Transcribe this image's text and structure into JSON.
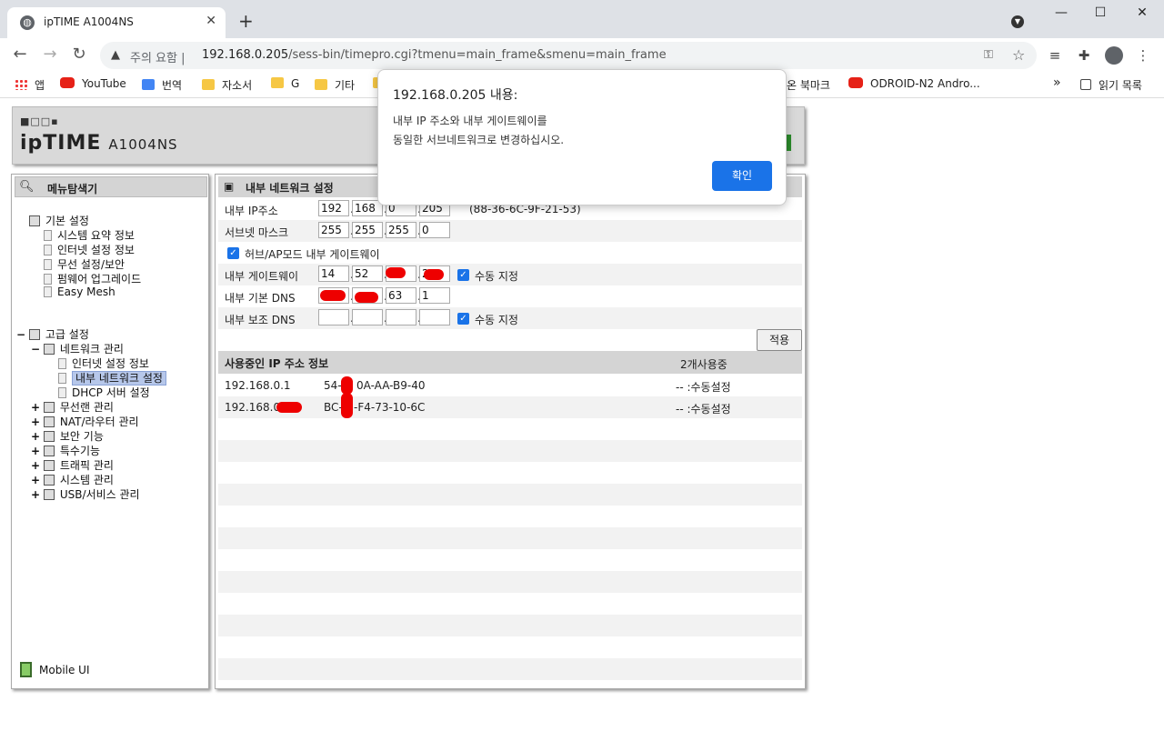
{
  "browser": {
    "tab_title": "ipTIME A1004NS",
    "tab_close": "✕",
    "new_tab": "+",
    "window_controls": {
      "minimize": "—",
      "maximize": "☐",
      "close": "✕"
    },
    "security_label": "주의 요함",
    "url_host": "192.168.0.205",
    "url_path": "/sess-bin/timepro.cgi?tmenu=main_frame&smenu=main_frame",
    "bookmarks": [
      "앱",
      "YouTube",
      "번역",
      "자소서",
      "G",
      "기타",
      "온 북마크",
      "ODROID-N2 Andro..."
    ],
    "bookmark_overflow": "»",
    "reading_list": "읽기 목록"
  },
  "router": {
    "logo_text": "ipTIME",
    "model": "A1004NS",
    "menu_title": "메뉴탐색기",
    "tree": {
      "basic": "기본 설정",
      "basic_items": [
        "시스템 요약 정보",
        "인터넷 설정 정보",
        "무선 설정/보안",
        "펌웨어 업그레이드",
        "Easy Mesh"
      ],
      "advanced": "고급 설정",
      "network": "네트워크 관리",
      "network_items": [
        "인터넷 설정 정보",
        "내부 네트워크 설정",
        "DHCP 서버 설정"
      ],
      "other": [
        "무선랜 관리",
        "NAT/라우터 관리",
        "보안 기능",
        "특수기능",
        "트래픽 관리",
        "시스템 관리",
        "USB/서비스 관리"
      ]
    },
    "mobile_ui": "Mobile UI",
    "panel_title": "내부 네트워크 설정",
    "fields": {
      "ip_label": "내부 IP주소",
      "ip": [
        "192",
        "168",
        "0",
        "205"
      ],
      "mac": "(88-36-6C-9F-21-53)",
      "mask_label": "서브넷 마스크",
      "mask": [
        "255",
        "255",
        "255",
        "0"
      ],
      "hub_label": "허브/AP모드 내부 게이트웨이",
      "gw_label": "내부 게이트웨이",
      "gw": [
        "14",
        "52",
        "",
        "2"
      ],
      "manual_label": "수동 지정",
      "dns1_label": "내부 기본 DNS",
      "dns1": [
        "",
        "",
        "63",
        "1"
      ],
      "dns2_label": "내부 보조 DNS",
      "dns2": [
        "",
        "",
        "",
        ""
      ]
    },
    "apply_label": "적용",
    "used_title": "사용중인 IP 주소 정보",
    "used_count": "2개사용중",
    "used_rows": [
      {
        "ip": "192.168.0.1",
        "mac": "54-",
        "mac2": "0A-AA-B9-40",
        "type": "-- :수동설정"
      },
      {
        "ip": "192.168.0.",
        "mac": "BC-",
        "mac2": "-F4-73-10-6C",
        "type": "-- :수동설정"
      }
    ]
  },
  "dialog": {
    "title": "192.168.0.205 내용:",
    "message": "내부 IP 주소와 내부 게이트웨이를\n동일한 서브네트워크로 변경하십시오.",
    "ok": "확인"
  }
}
